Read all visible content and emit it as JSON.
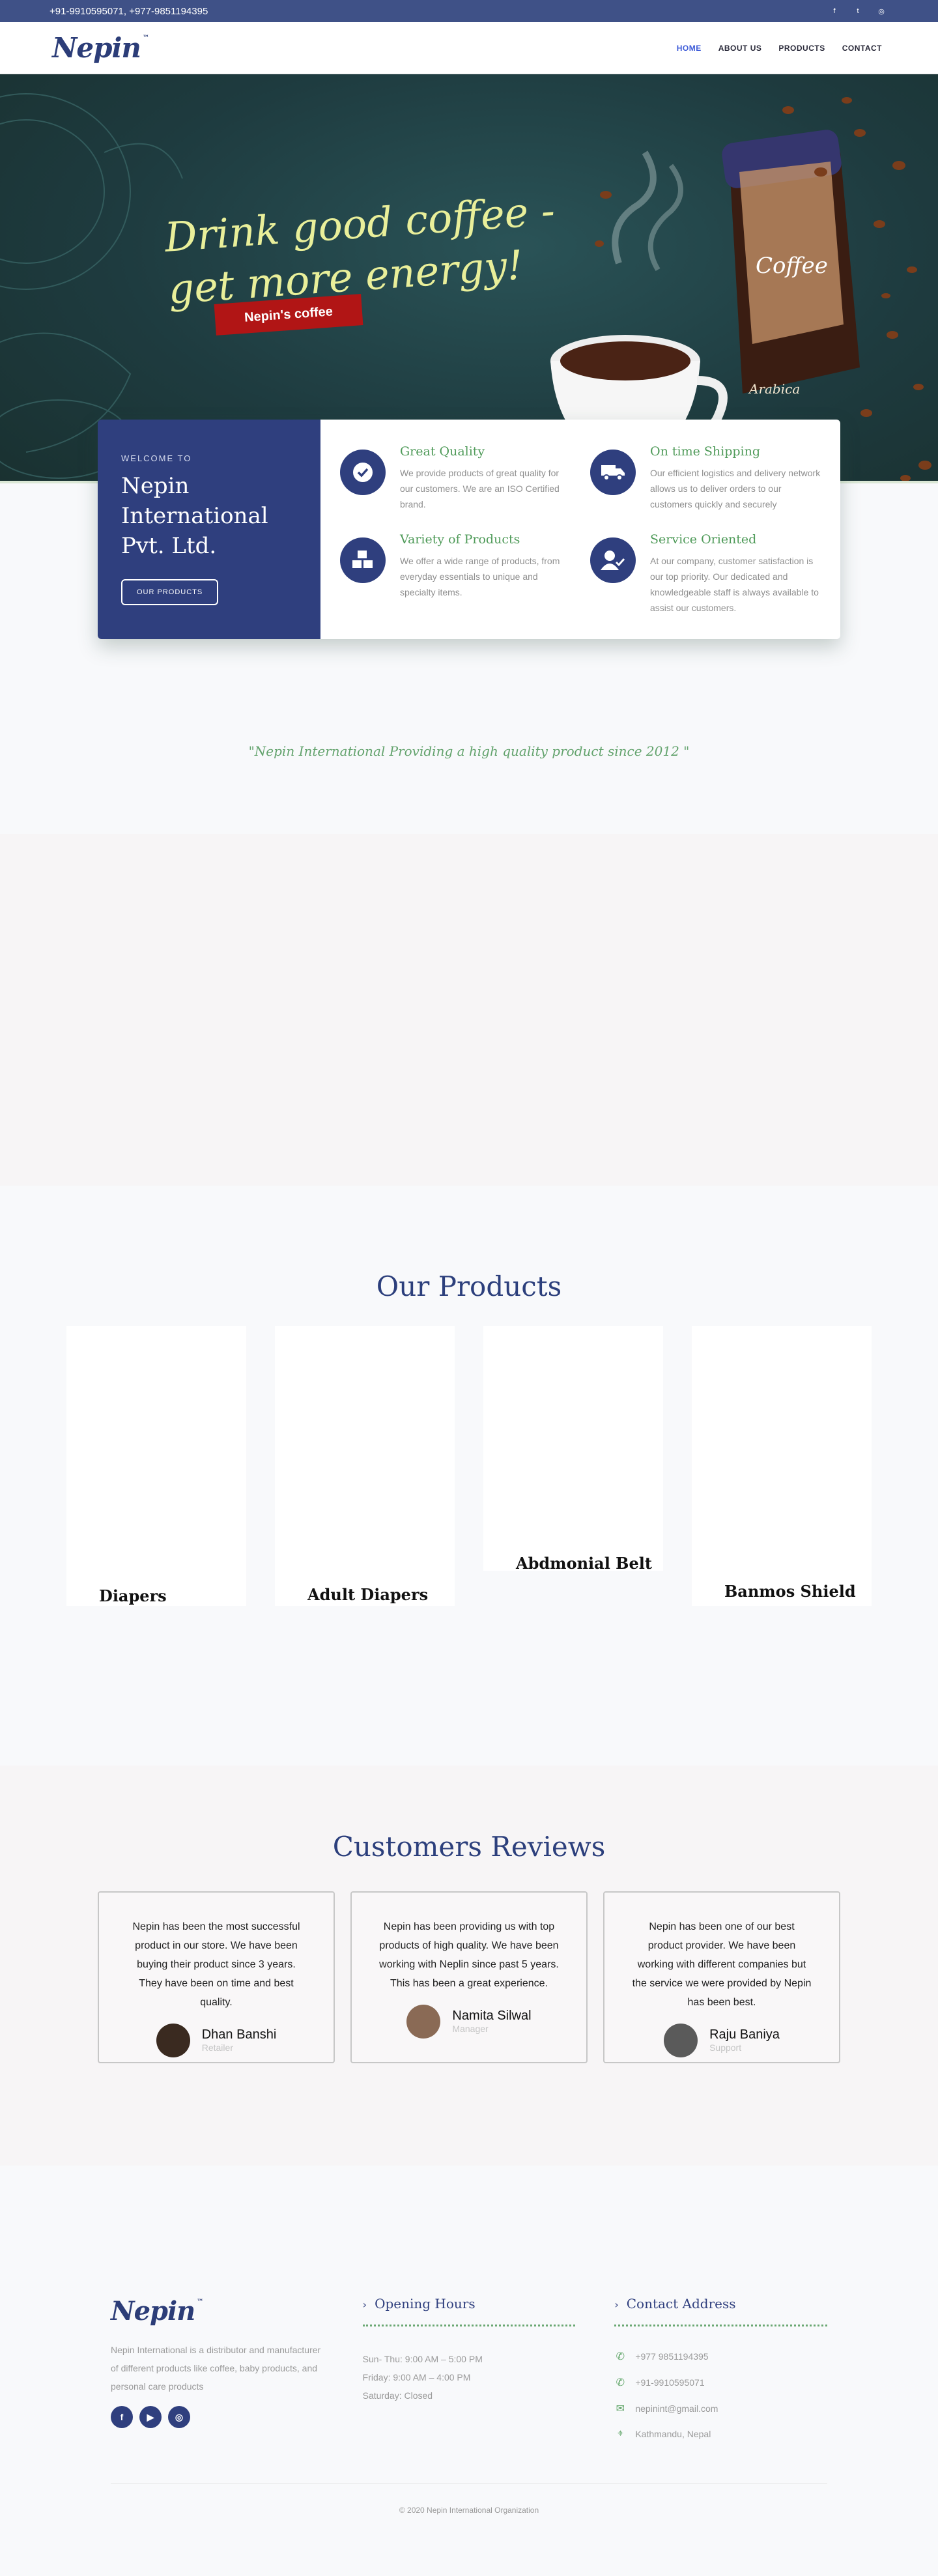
{
  "topbar": {
    "phones": "+91-9910595071, +977-9851194395",
    "socials": [
      {
        "icon": "facebook-icon",
        "glyph": "f"
      },
      {
        "icon": "twitter-icon",
        "glyph": "t"
      },
      {
        "icon": "instagram-icon",
        "glyph": "◎"
      }
    ]
  },
  "brand": {
    "logo": "Nepin",
    "tm": "™"
  },
  "nav": {
    "home": "HOME",
    "about": "ABOUT US",
    "products": "PRODUCTS",
    "contact": "CONTACT"
  },
  "hero": {
    "line1": "Drink good coffee -",
    "line2": "get more energy!",
    "ribbon": "Nepin's coffee",
    "jar_label": "Coffee",
    "jar_sub": "Arabica"
  },
  "intro": {
    "welcome": "WELCOME TO",
    "company": "Nepin International Pvt. Ltd.",
    "button": "OUR PRODUCTS"
  },
  "features": [
    {
      "title": "Great Quality",
      "text": "We provide products of great quality for our customers. We are an ISO Certified brand.",
      "icon": "check-circle-icon"
    },
    {
      "title": "On time Shipping",
      "text": "Our efficient logistics and delivery network allows us to deliver orders to our customers quickly and securely",
      "icon": "truck-icon"
    },
    {
      "title": "Variety of Products",
      "text": "We offer a wide range of products, from everyday essentials to unique and specialty items.",
      "icon": "boxes-icon"
    },
    {
      "title": "Service Oriented",
      "text": "At our company, customer satisfaction is our top priority. Our dedicated and knowledgeable staff is always available to assist our customers.",
      "icon": "user-check-icon"
    }
  ],
  "quote": "\"Nepin International Providing a high quality product since 2012 \"",
  "products": {
    "title": "Our Products",
    "items": [
      "Diapers",
      "Adult Diapers",
      "Abdmonial Belt",
      "Banmos Shield"
    ]
  },
  "reviews": {
    "title": "Customers Reviews",
    "items": [
      {
        "text": "Nepin has been the most successful product in our store. We have been buying their product since 3 years. They have been on time and best quality.",
        "name": "Dhan Banshi",
        "role": "Retailer",
        "avatar_color": "#3a2a20"
      },
      {
        "text": "Nepin has been providing us with top products of high quality. We have been working with Neplin since past 5 years. This has been a great experience.",
        "name": "Namita Silwal",
        "role": "Manager",
        "avatar_color": "#8a6a55"
      },
      {
        "text": "Nepin has been one of our best product provider. We have been working with different companies but the service we were provided by Nepin has been best.",
        "name": "Raju Baniya",
        "role": "Support",
        "avatar_color": "#5a5a5a"
      }
    ]
  },
  "footer": {
    "about": "Nepin International is a distributor and manufacturer of different products like coffee, baby products, and personal care products",
    "socials": [
      {
        "icon": "facebook-icon",
        "glyph": "f"
      },
      {
        "icon": "youtube-icon",
        "glyph": "▶"
      },
      {
        "icon": "instagram-icon",
        "glyph": "◎"
      }
    ],
    "hours_title": "Opening Hours",
    "hours": [
      "Sun- Thu: 9:00 AM – 5:00 PM",
      "Friday: 9:00 AM – 4:00 PM",
      "Saturday: Closed"
    ],
    "contact_title": "Contact Address",
    "contacts": [
      {
        "icon": "whatsapp-icon",
        "glyph": "✆",
        "text": "+977 9851194395"
      },
      {
        "icon": "whatsapp-icon",
        "glyph": "✆",
        "text": "+91-9910595071"
      },
      {
        "icon": "email-icon",
        "glyph": "✉",
        "text": "nepinint@gmail.com"
      },
      {
        "icon": "map-icon",
        "glyph": "⌖",
        "text": "Kathmandu, Nepal"
      }
    ],
    "copyright": "© 2020 Nepin International Organization"
  },
  "colors": {
    "brand": "#2f3f7e",
    "accent_green": "#4e9a58",
    "topbar": "#3f5187",
    "ribbon": "#b11515"
  }
}
